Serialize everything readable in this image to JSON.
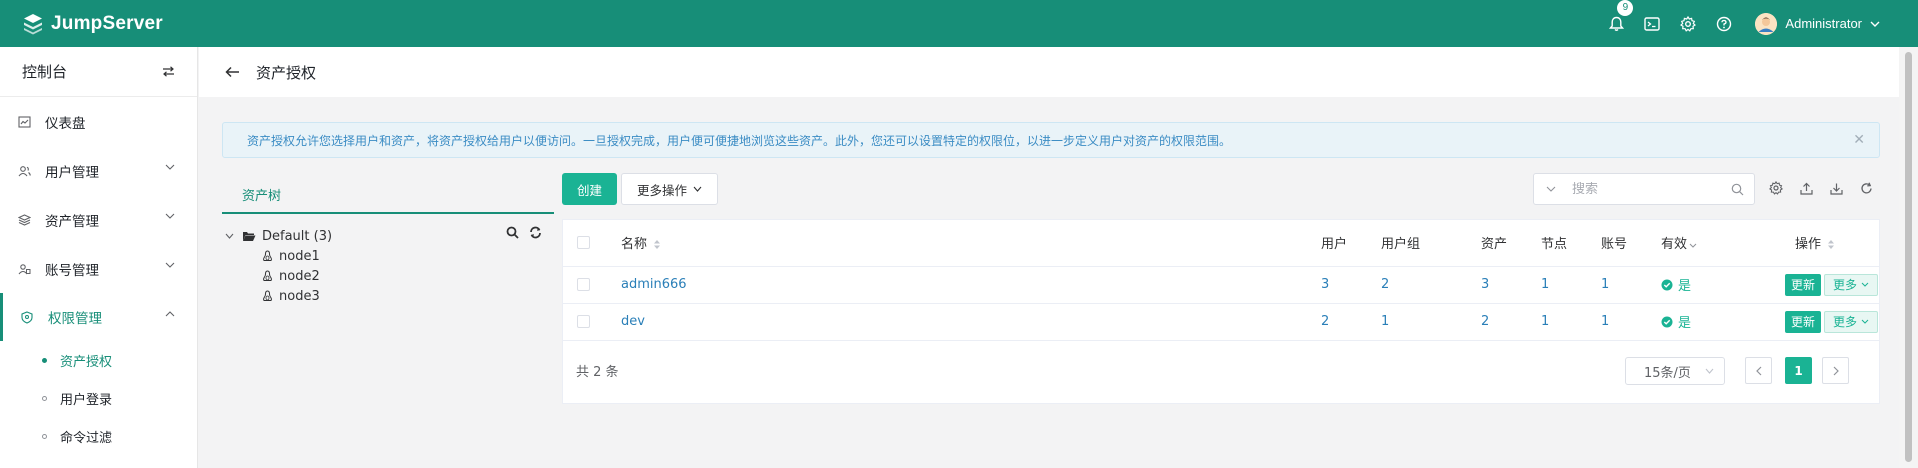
{
  "header": {
    "app_name": "JumpServer",
    "notification_count": "9",
    "user_name": "Administrator"
  },
  "sidebar": {
    "title": "控制台",
    "items": [
      {
        "label": "仪表盘",
        "icon": "dashboard-icon"
      },
      {
        "label": "用户管理",
        "icon": "users-icon"
      },
      {
        "label": "资产管理",
        "icon": "assets-icon"
      },
      {
        "label": "账号管理",
        "icon": "accounts-icon"
      },
      {
        "label": "权限管理",
        "icon": "shield-icon"
      }
    ],
    "sub_items": [
      {
        "label": "资产授权"
      },
      {
        "label": "用户登录"
      },
      {
        "label": "命令过滤"
      }
    ]
  },
  "page": {
    "title": "资产授权"
  },
  "alert": {
    "text": "资产授权允许您选择用户和资产，将资产授权给用户以便访问。一旦授权完成，用户便可便捷地浏览这些资产。此外，您还可以设置特定的权限位，以进一步定义用户对资产的权限范围。"
  },
  "tree": {
    "tab_label": "资产树",
    "root_label": "Default (3)",
    "nodes": [
      "node1",
      "node2",
      "node3"
    ]
  },
  "toolbar": {
    "create_label": "创建",
    "more_label": "更多操作",
    "search_placeholder": "搜索"
  },
  "table": {
    "columns": [
      "名称",
      "用户",
      "用户组",
      "资产",
      "节点",
      "账号",
      "有效",
      "操作"
    ],
    "rows": [
      {
        "name": "admin666",
        "users": "3",
        "user_groups": "2",
        "assets": "3",
        "nodes": "1",
        "accounts": "1",
        "valid": "是"
      },
      {
        "name": "dev",
        "users": "2",
        "user_groups": "1",
        "assets": "2",
        "nodes": "1",
        "accounts": "1",
        "valid": "是"
      }
    ],
    "update_label": "更新",
    "more_label": "更多"
  },
  "pagination": {
    "total_text": "共 2 条",
    "page_size": "15条/页",
    "current_page": "1"
  },
  "colors": {
    "brand": "#178e78",
    "accent": "#1ab394",
    "link": "#2a7fb8"
  }
}
